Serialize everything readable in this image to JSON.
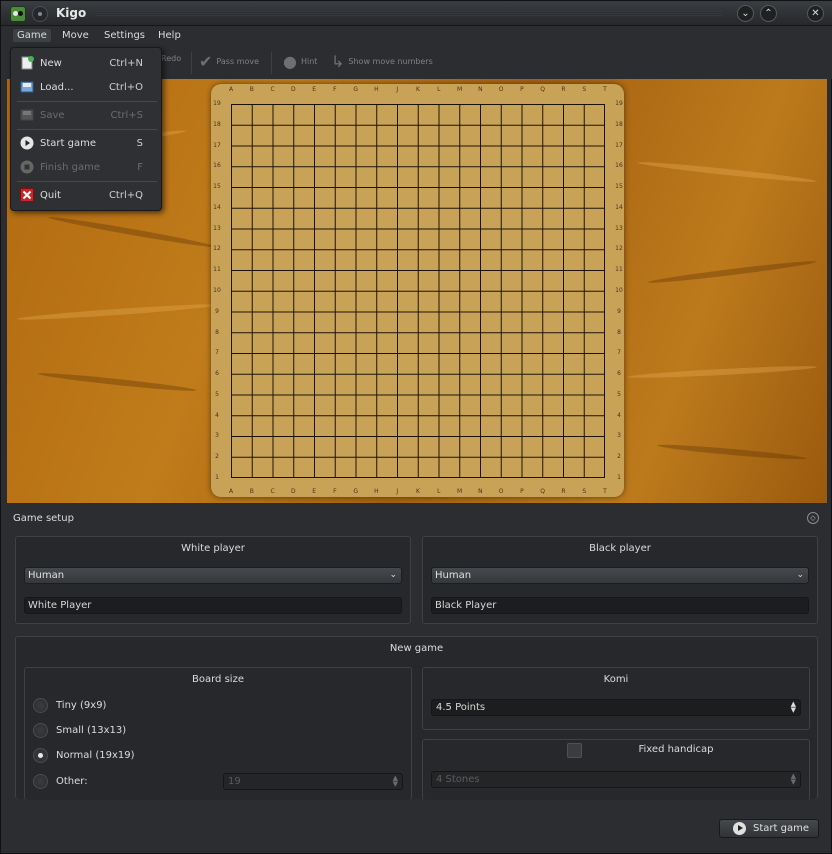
{
  "window": {
    "title": "Kigo"
  },
  "menubar": {
    "items": [
      "Game",
      "Move",
      "Settings",
      "Help"
    ]
  },
  "toolbar": {
    "redo_label": "Redo",
    "pass_label": "Pass move",
    "hint_label": "Hint",
    "numbers_label": "Show move numbers"
  },
  "game_menu": {
    "items": [
      {
        "label": "New",
        "shortcut": "Ctrl+N",
        "icon": "new-document-icon",
        "enabled": true
      },
      {
        "label": "Load...",
        "shortcut": "Ctrl+O",
        "icon": "load-icon",
        "enabled": true
      },
      {
        "label": "Save",
        "shortcut": "Ctrl+S",
        "icon": "save-icon",
        "enabled": false
      },
      {
        "label": "Start game",
        "shortcut": "S",
        "icon": "play-icon",
        "enabled": true
      },
      {
        "label": "Finish game",
        "shortcut": "F",
        "icon": "stop-icon",
        "enabled": false
      },
      {
        "label": "Quit",
        "shortcut": "Ctrl+Q",
        "icon": "quit-icon",
        "enabled": true
      }
    ]
  },
  "board": {
    "columns": [
      "A",
      "B",
      "C",
      "D",
      "E",
      "F",
      "G",
      "H",
      "J",
      "K",
      "L",
      "M",
      "N",
      "O",
      "P",
      "Q",
      "R",
      "S",
      "T"
    ],
    "rows": [
      "19",
      "18",
      "17",
      "16",
      "15",
      "14",
      "13",
      "12",
      "11",
      "10",
      "9",
      "8",
      "7",
      "6",
      "5",
      "4",
      "3",
      "2",
      "1"
    ]
  },
  "setup": {
    "title": "Game setup",
    "white": {
      "title": "White player",
      "type": "Human",
      "name": "White Player"
    },
    "black": {
      "title": "Black player",
      "type": "Human",
      "name": "Black Player"
    },
    "new_game": {
      "title": "New game",
      "board_size": {
        "title": "Board size",
        "options": [
          "Tiny (9x9)",
          "Small (13x13)",
          "Normal (19x19)",
          "Other:"
        ],
        "selected": "Normal (19x19)",
        "other_value": "19"
      },
      "komi": {
        "title": "Komi",
        "value": "4.5 Points"
      },
      "handicap": {
        "title": "Fixed handicap",
        "checked": false,
        "value": "4 Stones"
      }
    },
    "start_button": "Start game"
  }
}
